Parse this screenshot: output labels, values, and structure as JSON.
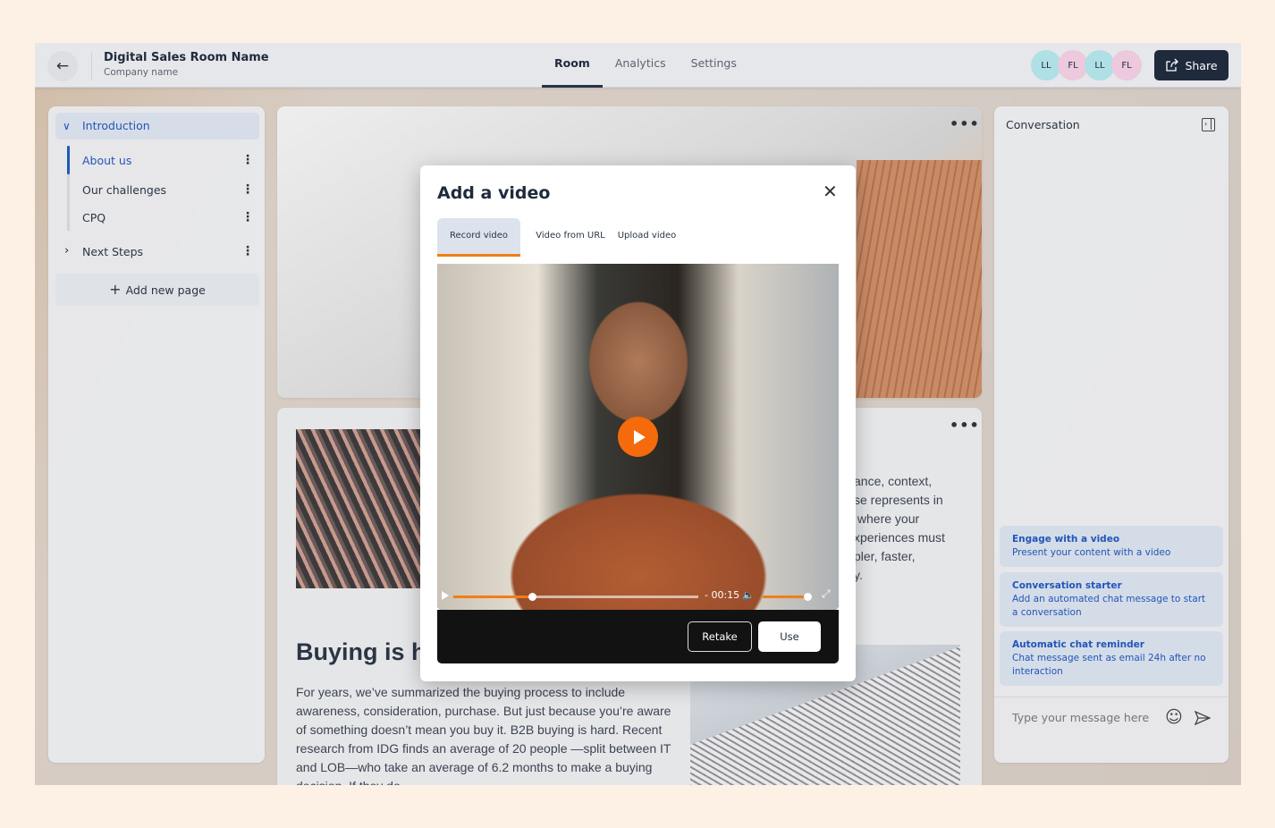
{
  "header": {
    "title": "Digital Sales Room Name",
    "subtitle": "Company name",
    "tabs": [
      {
        "label": "Room",
        "active": true
      },
      {
        "label": "Analytics"
      },
      {
        "label": "Settings"
      }
    ],
    "avatars": [
      {
        "initials": "LL",
        "color": "#aee0e6"
      },
      {
        "initials": "FL",
        "color": "#ecc9dc"
      },
      {
        "initials": "LL",
        "color": "#aee0e6"
      },
      {
        "initials": "FL",
        "color": "#ecc9dc"
      }
    ],
    "share_label": "Share"
  },
  "sidebar": {
    "section": "Introduction",
    "items": [
      {
        "label": "About us",
        "active": true
      },
      {
        "label": "Our challenges"
      },
      {
        "label": "CPQ"
      }
    ],
    "next_section": "Next Steps",
    "add_page": "Add new page"
  },
  "content": {
    "heading": "Buying is h",
    "paragraph": "For years, we’ve summarized the buying process to include awareness, consideration, purchase. But just because you’re aware of something doesn’t mean you buy it. B2B buying is hard. Recent research from IDG finds an average of 20 people —split between IT and LOB—who take an average of 6.2 months to make a buying decision. If they do",
    "side_paragraph": "ance, context,\nse represents in\n where your\nxperiences must\npler, faster,\ny."
  },
  "conversation": {
    "title": "Conversation",
    "suggestions": [
      {
        "title": "Engage with a video",
        "desc": "Present your content with a video"
      },
      {
        "title": "Conversation starter",
        "desc": "Add an automated chat message to start a conversation"
      },
      {
        "title": "Automatic chat reminder",
        "desc": "Chat message sent as email 24h after no interaction"
      }
    ],
    "input_placeholder": "Type your message here"
  },
  "modal": {
    "title": "Add a video",
    "tabs": [
      {
        "label": "Record video",
        "active": true
      },
      {
        "label": "Video from URL"
      },
      {
        "label": "Upload video"
      }
    ],
    "player": {
      "time": "- 00:15",
      "progress": 0.32,
      "volume": 1.0
    },
    "retake": "Retake",
    "use": "Use"
  },
  "colors": {
    "accent": "#f07f16",
    "primary": "#2156b8",
    "dark": "#1f2a3c"
  }
}
